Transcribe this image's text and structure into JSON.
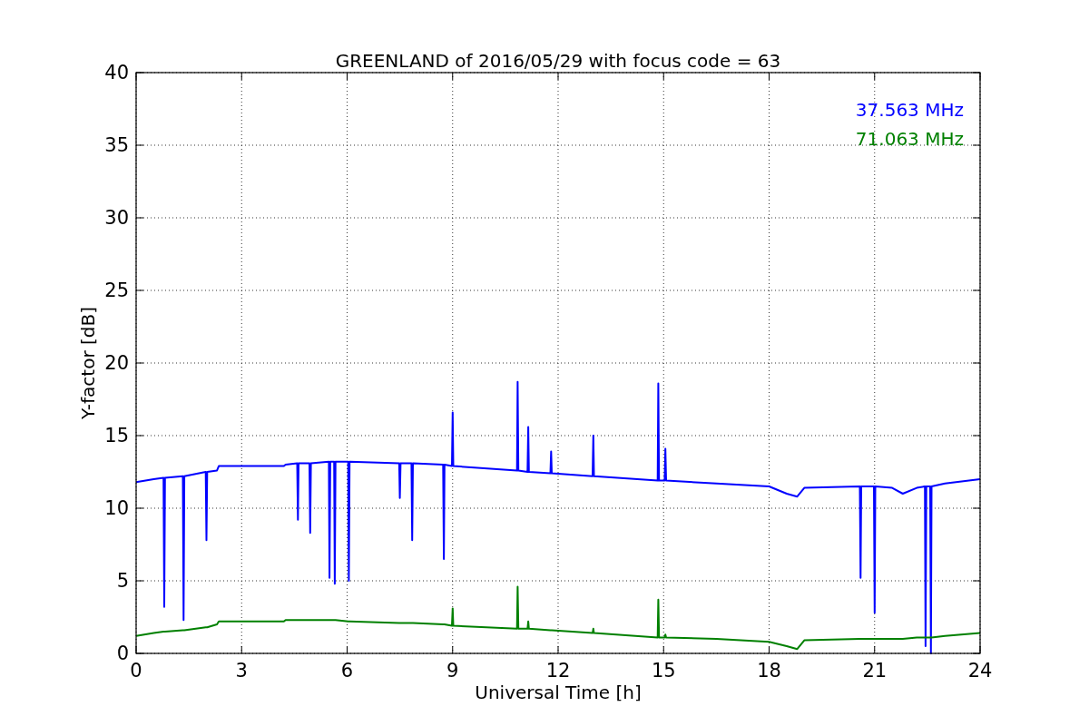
{
  "figure": {
    "chart_data": {
      "type": "line",
      "title": "GREENLAND of 2016/05/29 with focus code = 63",
      "xlabel": "Universal Time [h]",
      "ylabel": "Y-factor [dB]",
      "xlim": [
        0,
        24
      ],
      "ylim": [
        0,
        40
      ],
      "xticks": [
        0,
        3,
        6,
        9,
        12,
        15,
        18,
        21,
        24
      ],
      "yticks": [
        0,
        5,
        10,
        15,
        20,
        25,
        30,
        35,
        40
      ],
      "grid": true,
      "x": [
        0,
        0.5,
        0.78,
        0.8,
        0.82,
        1.33,
        1.35,
        1.37,
        1.98,
        2.0,
        2.02,
        2.3,
        2.35,
        4.2,
        4.25,
        4.58,
        4.6,
        4.62,
        4.93,
        4.95,
        4.97,
        5.48,
        5.5,
        5.52,
        5.63,
        5.65,
        5.67,
        6.03,
        6.05,
        6.07,
        7.48,
        7.5,
        7.52,
        7.83,
        7.85,
        7.87,
        8.73,
        8.75,
        8.77,
        8.98,
        9.0,
        9.02,
        10.83,
        10.85,
        10.87,
        11.13,
        11.15,
        11.17,
        11.78,
        11.8,
        11.82,
        12.98,
        13.0,
        13.02,
        14.83,
        14.85,
        14.87,
        15.03,
        15.05,
        15.07,
        16.5,
        18.0,
        18.5,
        18.8,
        19.0,
        20.58,
        20.6,
        20.62,
        20.98,
        21.0,
        21.02,
        21.5,
        21.8,
        22.2,
        22.43,
        22.45,
        22.47,
        22.58,
        22.6,
        22.62,
        23.0,
        24.0
      ],
      "series": [
        {
          "name": "37.563 MHz",
          "color": "#0000ff",
          "values": [
            11.8,
            12.0,
            12.1,
            3.2,
            12.1,
            12.2,
            2.3,
            12.2,
            12.5,
            7.8,
            12.5,
            12.6,
            12.9,
            12.9,
            13.0,
            13.1,
            9.2,
            13.1,
            13.1,
            8.3,
            13.1,
            13.2,
            5.2,
            13.2,
            13.2,
            4.8,
            13.2,
            13.2,
            5.0,
            13.2,
            13.1,
            10.7,
            13.1,
            13.1,
            7.8,
            13.1,
            13.0,
            6.5,
            13.0,
            12.9,
            16.6,
            12.9,
            12.6,
            18.7,
            12.6,
            12.5,
            15.6,
            12.5,
            12.4,
            13.9,
            12.4,
            12.2,
            15.0,
            12.2,
            11.9,
            18.6,
            11.9,
            11.9,
            14.1,
            11.9,
            11.7,
            11.5,
            11.0,
            10.8,
            11.4,
            11.5,
            5.2,
            11.5,
            11.5,
            2.8,
            11.5,
            11.4,
            11.0,
            11.4,
            11.5,
            0.5,
            11.5,
            11.5,
            0,
            11.5,
            11.7,
            12.0
          ]
        },
        {
          "name": "71.063 MHz",
          "color": "#008000",
          "values": [
            1.2,
            1.4,
            1.5,
            1.5,
            1.5,
            1.6,
            1.6,
            1.6,
            1.8,
            1.8,
            1.8,
            2.0,
            2.2,
            2.2,
            2.3,
            2.3,
            2.3,
            2.3,
            2.3,
            2.3,
            2.3,
            2.3,
            2.3,
            2.3,
            2.3,
            2.3,
            2.3,
            2.2,
            2.2,
            2.2,
            2.1,
            2.1,
            2.1,
            2.1,
            2.1,
            2.1,
            2.0,
            2.0,
            2.0,
            1.9,
            3.1,
            1.9,
            1.7,
            4.6,
            1.7,
            1.7,
            2.2,
            1.7,
            1.6,
            1.6,
            1.6,
            1.4,
            1.7,
            1.4,
            1.1,
            3.7,
            1.1,
            1.1,
            1.3,
            1.1,
            1.0,
            0.8,
            0.5,
            0.3,
            0.9,
            1.0,
            1.0,
            1.0,
            1.0,
            1.0,
            1.0,
            1.0,
            1.0,
            1.1,
            1.1,
            1.1,
            1.1,
            1.1,
            1.1,
            1.1,
            1.2,
            1.4
          ]
        }
      ]
    }
  }
}
